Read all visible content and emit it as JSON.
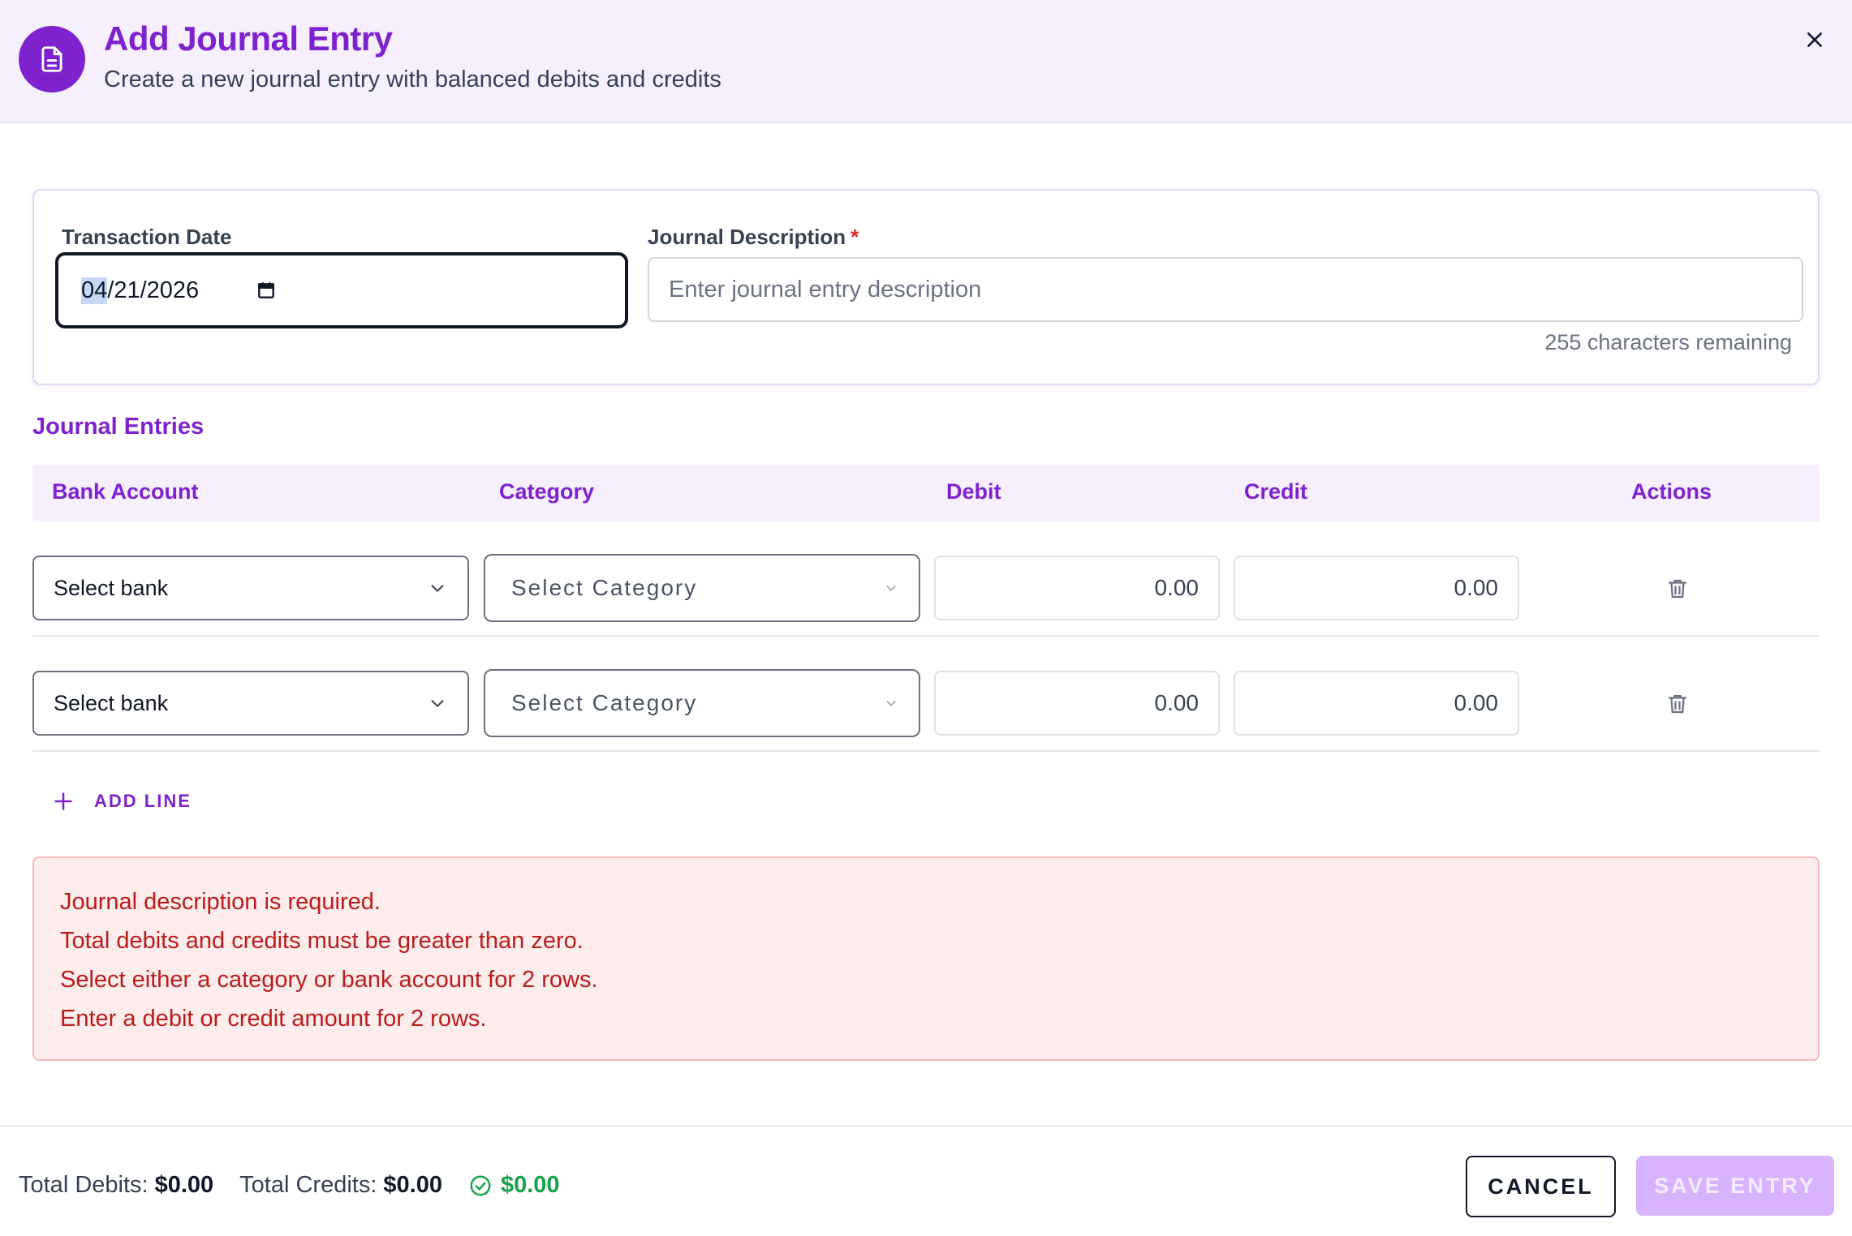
{
  "header": {
    "title": "Add Journal Entry",
    "subtitle": "Create a new journal entry with balanced debits and credits",
    "icon": "document-icon"
  },
  "form": {
    "date_label": "Transaction Date",
    "date_month": "04",
    "date_rest": "/21/2026",
    "description_label": "Journal Description",
    "required_mark": "*",
    "description_placeholder": "Enter journal entry description",
    "description_value": "",
    "chars_remaining": "255 characters remaining"
  },
  "entries": {
    "section_title": "Journal Entries",
    "columns": [
      "Bank Account",
      "Category",
      "Debit",
      "Credit",
      "Actions"
    ],
    "rows": [
      {
        "bank": "Select bank",
        "category": "Select Category",
        "debit": "0.00",
        "credit": "0.00"
      },
      {
        "bank": "Select bank",
        "category": "Select Category",
        "debit": "0.00",
        "credit": "0.00"
      }
    ],
    "add_line_label": "ADD LINE"
  },
  "errors": [
    "Journal description is required.",
    "Total debits and credits must be greater than zero.",
    "Select either a category or bank account for 2 rows.",
    "Enter a debit or credit amount for 2 rows."
  ],
  "footer": {
    "total_debits_label": "Total Debits:",
    "total_debits_value": "$0.00",
    "total_credits_label": "Total Credits:",
    "total_credits_value": "$0.00",
    "balance_value": "$0.00",
    "cancel_label": "CANCEL",
    "save_label": "SAVE ENTRY"
  },
  "colors": {
    "accent": "#7e22ce",
    "header_bg": "#f6f0fe",
    "error_text": "#b91c1c",
    "error_bg": "#fdecec",
    "success": "#16a34a",
    "save_disabled": "#d8b4fe"
  }
}
